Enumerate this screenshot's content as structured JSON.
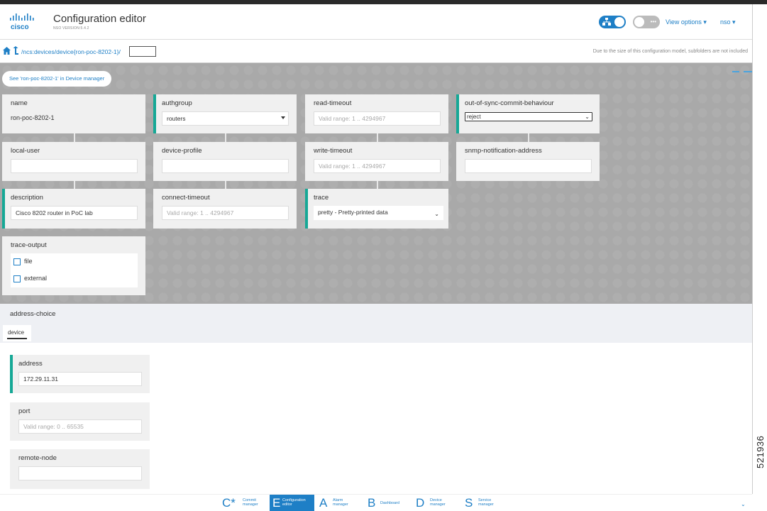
{
  "header": {
    "logo_text": "cisco",
    "title": "Configuration editor",
    "version": "NSO VERSION:5.4.2",
    "view_options": "View options ▾",
    "user": "nso ▾"
  },
  "pathbar": {
    "path": "/ncs:devices/device{ron-poc-8202-1}/",
    "note": "Due to the size of this configuration model, subfolders are not included"
  },
  "see_button": "See 'ron-poc-8202-1' in Device manager",
  "fields": {
    "name": {
      "label": "name",
      "value": "ron-poc-8202-1"
    },
    "authgroup": {
      "label": "authgroup",
      "value": "routers"
    },
    "read_timeout": {
      "label": "read-timeout",
      "placeholder": "Valid range: 1 .. 4294967"
    },
    "out_of_sync": {
      "label": "out-of-sync-commit-behaviour",
      "value": "reject"
    },
    "local_user": {
      "label": "local-user"
    },
    "device_profile": {
      "label": "device-profile"
    },
    "write_timeout": {
      "label": "write-timeout",
      "placeholder": "Valid range: 1 .. 4294967"
    },
    "snmp": {
      "label": "snmp-notification-address"
    },
    "description": {
      "label": "description",
      "value": "Cisco 8202 router in PoC lab"
    },
    "connect_timeout": {
      "label": "connect-timeout",
      "placeholder": "Valid range: 1 .. 4294967"
    },
    "trace": {
      "label": "trace",
      "value": "pretty - Pretty-printed data"
    },
    "trace_output": {
      "label": "trace-output",
      "options": [
        "file",
        "external"
      ]
    }
  },
  "address_choice": {
    "title": "address-choice",
    "tab": "device",
    "address": {
      "label": "address",
      "value": "172.29.11.31"
    },
    "port": {
      "label": "port",
      "placeholder": "Valid range: 0 .. 65535"
    },
    "remote_node": {
      "label": "remote-node"
    }
  },
  "bottom_nav": [
    {
      "letter": "C*",
      "name1": "Commit",
      "name2": "manager"
    },
    {
      "letter": "E",
      "name1": "Configuration",
      "name2": "editor"
    },
    {
      "letter": "A",
      "name1": "Alarm",
      "name2": "manager"
    },
    {
      "letter": "B",
      "name1": "Dashboard",
      "name2": ""
    },
    {
      "letter": "D",
      "name1": "Device",
      "name2": "manager"
    },
    {
      "letter": "S",
      "name1": "Service",
      "name2": "manager"
    }
  ],
  "side_code": "521936",
  "colors": {
    "accent": "#1e7fc6",
    "required_bar": "#16a896",
    "canvas_gray": "#a9a9a9"
  }
}
